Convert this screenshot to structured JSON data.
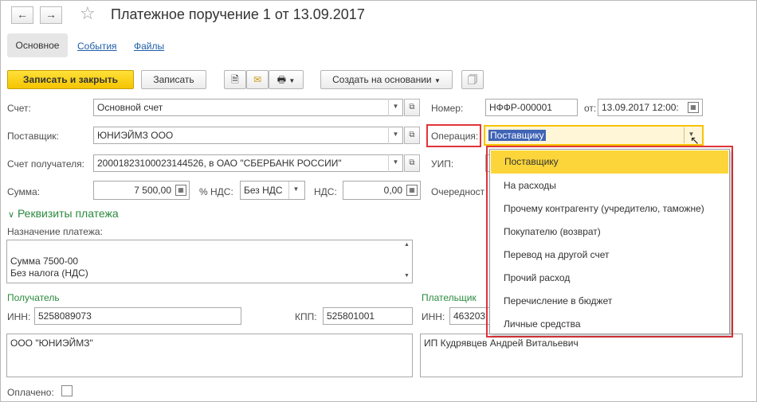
{
  "title": "Платежное поручение 1 от 13.09.2017",
  "tabs": [
    {
      "label": "Основное"
    },
    {
      "label": "События"
    },
    {
      "label": "Файлы"
    }
  ],
  "toolbar": {
    "save_close": "Записать и закрыть",
    "save": "Записать",
    "create_based": "Создать на основании"
  },
  "form": {
    "account_label": "Счет:",
    "account_value": "Основной счет",
    "supplier_label": "Поставщик:",
    "supplier_value": "ЮНИЭЙМЗ ООО",
    "recipient_account_label": "Счет получателя:",
    "recipient_account_value": "20001823100023144526, в ОАО \"СБЕРБАНК РОССИИ\"",
    "sum_label": "Сумма:",
    "sum_value": "7 500,00",
    "vat_rate_label": "% НДС:",
    "vat_rate_value": "Без НДС",
    "vat_label": "НДС:",
    "vat_value": "0,00",
    "number_label": "Номер:",
    "number_value": "НФФР-000001",
    "date_label": "от:",
    "date_value": "13.09.2017 12:00:",
    "operation_label": "Операция:",
    "operation_value": "Поставщику",
    "uip_label": "УИП:",
    "priority_label": "Очередност"
  },
  "payment": {
    "section_title": "Реквизиты платежа",
    "purpose_label": "Назначение платежа:",
    "purpose_lines": "Сумма 7500-00\nБез налога (НДС)"
  },
  "recipient": {
    "title": "Получатель",
    "inn_label": "ИНН:",
    "inn_value": "5258089073",
    "kpp_label": "КПП:",
    "kpp_value": "525801001",
    "name": "ООО \"ЮНИЭЙМЗ\""
  },
  "payer": {
    "title": "Плательщик",
    "inn_label": "ИНН:",
    "inn_value": "463203",
    "name": "ИП Кудрявцев Андрей Витальевич"
  },
  "paid_label": "Оплачено:",
  "operation_options": [
    {
      "label": "Поставщику"
    },
    {
      "label": "На расходы"
    },
    {
      "label": "Прочему контрагенту (учредителю, таможне)"
    },
    {
      "label": "Покупателю (возврат)"
    },
    {
      "label": "Перевод на другой счет"
    },
    {
      "label": "Прочий расход"
    },
    {
      "label": "Перечисление в бюджет"
    },
    {
      "label": "Личные средства"
    }
  ],
  "colors": {
    "accent_yellow": "#f5c400",
    "highlight_red": "#e0343a",
    "link_blue": "#1f5fa8",
    "section_green": "#2b8a3e"
  }
}
